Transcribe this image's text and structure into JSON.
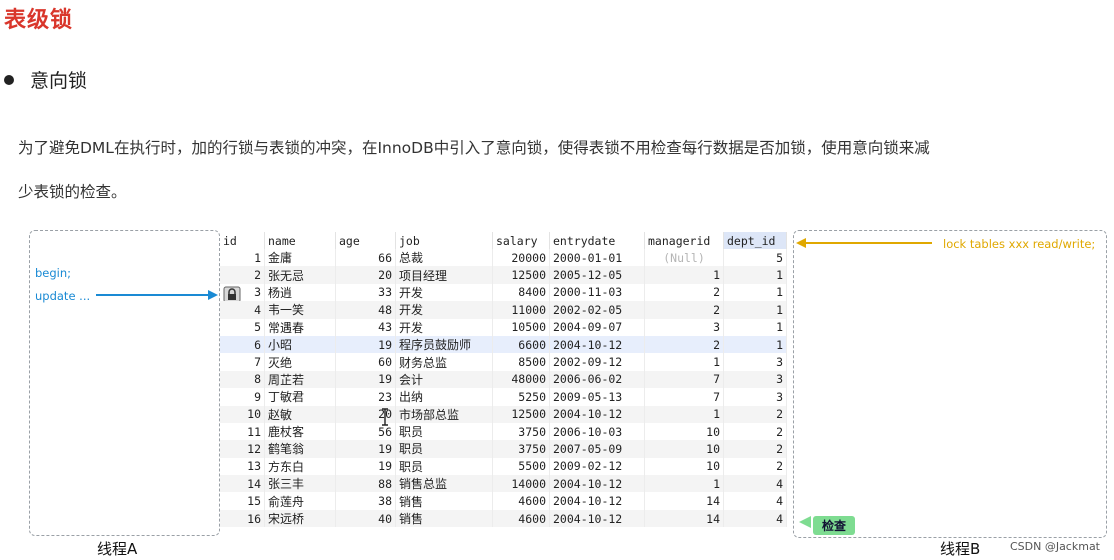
{
  "title": "表级锁",
  "bullet": "意向锁",
  "description": {
    "line1": "为了避免DML在执行时，加的行锁与表锁的冲突，在InnoDB中引入了意向锁，使得表锁不用检查每行数据是否加锁，使用意向锁来减",
    "line2": "少表锁的检查。"
  },
  "thread_a": {
    "label": "线程A",
    "begin": "begin;",
    "update": "update ..."
  },
  "thread_b": {
    "label": "线程B",
    "lock": "lock tables xxx read/write;",
    "check": "检查"
  },
  "table": {
    "columns": [
      "id",
      "name",
      "age",
      "job",
      "salary",
      "entrydate",
      "managerid",
      "dept_id"
    ],
    "rows": [
      [
        "1",
        "金庸",
        "66",
        "总裁",
        "20000",
        "2000-01-01",
        "(Null)",
        "5"
      ],
      [
        "2",
        "张无忌",
        "20",
        "项目经理",
        "12500",
        "2005-12-05",
        "1",
        "1"
      ],
      [
        "3",
        "杨逍",
        "33",
        "开发",
        "8400",
        "2000-11-03",
        "2",
        "1"
      ],
      [
        "4",
        "韦一笑",
        "48",
        "开发",
        "11000",
        "2002-02-05",
        "2",
        "1"
      ],
      [
        "5",
        "常遇春",
        "43",
        "开发",
        "10500",
        "2004-09-07",
        "3",
        "1"
      ],
      [
        "6",
        "小昭",
        "19",
        "程序员鼓励师",
        "6600",
        "2004-10-12",
        "2",
        "1"
      ],
      [
        "7",
        "灭绝",
        "60",
        "财务总监",
        "8500",
        "2002-09-12",
        "1",
        "3"
      ],
      [
        "8",
        "周芷若",
        "19",
        "会计",
        "48000",
        "2006-06-02",
        "7",
        "3"
      ],
      [
        "9",
        "丁敏君",
        "23",
        "出纳",
        "5250",
        "2009-05-13",
        "7",
        "3"
      ],
      [
        "10",
        "赵敏",
        "20",
        "市场部总监",
        "12500",
        "2004-10-12",
        "1",
        "2"
      ],
      [
        "11",
        "鹿杖客",
        "56",
        "职员",
        "3750",
        "2006-10-03",
        "10",
        "2"
      ],
      [
        "12",
        "鹤笔翁",
        "19",
        "职员",
        "3750",
        "2007-05-09",
        "10",
        "2"
      ],
      [
        "13",
        "方东白",
        "19",
        "职员",
        "5500",
        "2009-02-12",
        "10",
        "2"
      ],
      [
        "14",
        "张三丰",
        "88",
        "销售总监",
        "14000",
        "2004-10-12",
        "1",
        "4"
      ],
      [
        "15",
        "俞莲舟",
        "38",
        "销售",
        "4600",
        "2004-10-12",
        "14",
        "4"
      ],
      [
        "16",
        "宋远桥",
        "40",
        "销售",
        "4600",
        "2004-10-12",
        "14",
        "4"
      ]
    ]
  },
  "watermark": "CSDN @Jackmat",
  "colors": {
    "title": "#d9362b",
    "thread_a_notes": "#1a8ad4",
    "thread_b_note": "#e0a800",
    "check_badge": "#7edc91"
  },
  "icons": {
    "lock": "lock-icon",
    "cursor": "text-cursor-icon"
  }
}
